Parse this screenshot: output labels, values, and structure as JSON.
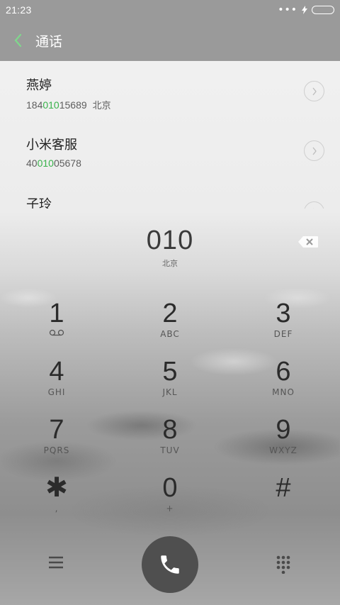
{
  "status": {
    "time": "21:23",
    "dots": "•••"
  },
  "header": {
    "title": "通话"
  },
  "contacts": [
    {
      "name": "燕婷",
      "num_pre": "184",
      "num_hl": "010",
      "num_post": "15689",
      "location": "北京"
    },
    {
      "name": "小米客服",
      "num_pre": "40",
      "num_hl": "010",
      "num_post": "05678",
      "location": ""
    },
    {
      "name": "子玲"
    }
  ],
  "display": {
    "digits": "010",
    "region": "北京"
  },
  "keys": [
    [
      {
        "num": "1",
        "sub": ""
      },
      {
        "num": "2",
        "sub": "ABC"
      },
      {
        "num": "3",
        "sub": "DEF"
      }
    ],
    [
      {
        "num": "4",
        "sub": "GHI"
      },
      {
        "num": "5",
        "sub": "JKL"
      },
      {
        "num": "6",
        "sub": "MNO"
      }
    ],
    [
      {
        "num": "7",
        "sub": "PQRS"
      },
      {
        "num": "8",
        "sub": "TUV"
      },
      {
        "num": "9",
        "sub": "WXYZ"
      }
    ],
    [
      {
        "num": "✱",
        "sub": ","
      },
      {
        "num": "0",
        "sub": "+"
      },
      {
        "num": "#",
        "sub": ""
      }
    ]
  ],
  "icons": {
    "back": "chevron-left-icon",
    "voicemail": "voicemail-icon",
    "backspace": "backspace-icon",
    "menu": "menu-icon",
    "call": "phone-icon",
    "keypad": "keypad-icon",
    "chevron": "chevron-right-icon"
  },
  "colors": {
    "accent": "#38b24a",
    "header": "#9a9a9a",
    "call_button": "#4f4f4f"
  }
}
